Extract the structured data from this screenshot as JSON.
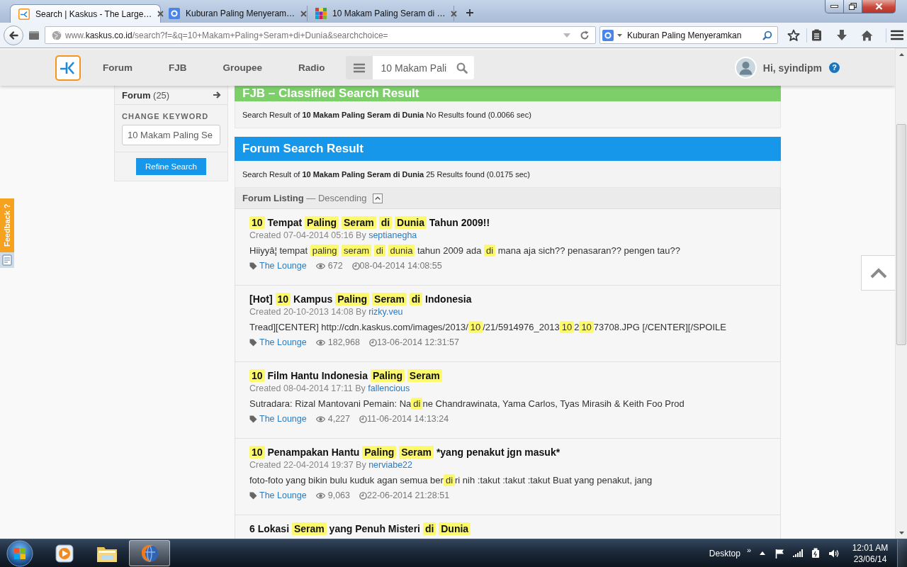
{
  "browser": {
    "tabs": [
      {
        "kind": "forum",
        "title": "Search | Kaskus - The Large…",
        "selected": true
      },
      {
        "kind": "search",
        "title": "Kuburan Paling Menyeram…",
        "selected": false
      },
      {
        "kind": "images",
        "title": "10 Makam Paling Seram di …",
        "selected": false
      }
    ],
    "address": {
      "prefix": "www.",
      "domain": "kaskus.co.id",
      "path": "/search?f=&q=10+Makam+Paling+Seram+di+Dunia&searchchoice="
    },
    "search": {
      "value": "Kuburan Paling Menyeramkan"
    }
  },
  "site_header": {
    "nav": [
      {
        "label": "Forum"
      },
      {
        "label": "FJB"
      },
      {
        "label": "Groupee"
      },
      {
        "label": "Radio"
      }
    ],
    "search": {
      "value": "10 Makam Pali"
    },
    "greeting": "Hi, syindipm",
    "help": "?"
  },
  "sidebar": {
    "category": "**Forum** (25)",
    "keyword_label": "CHANGE KEYWORD",
    "keyword": {
      "value": "10 Makam Paling Se"
    },
    "button": "Refine Search"
  },
  "sections": [
    {
      "kind": "classified",
      "title": "FJB – Classified Search Result",
      "summary": "Search Result of **10 Makam Paling Seram di Dunia** No Results found (0.0066 sec)"
    },
    {
      "kind": "forum",
      "title": "Forum Search Result",
      "summary": "Search Result of **10 Makam Paling Seram di Dunia** 25 Results found (0.0175 sec)"
    }
  ],
  "listing": {
    "label": "**Forum Listing** — Descending"
  },
  "results": [
    {
      "title": [
        {
          "text": "10",
          "highlight": true
        },
        {
          "text": " Tempat ",
          "highlight": false
        },
        {
          "text": "Paling ",
          "highlight": true
        },
        {
          "text": "Seram ",
          "highlight": true
        },
        {
          "text": "di ",
          "highlight": true
        },
        {
          "text": "Dunia",
          "highlight": true
        },
        {
          "text": " Tahun 2009!!",
          "highlight": false
        }
      ],
      "created": "Created 07-04-2014 05:16 By",
      "author": "septianegha",
      "snippet": [
        {
          "text": "Hiiyyâ¦ tempat ",
          "highlight": false
        },
        {
          "text": "paling ",
          "highlight": true
        },
        {
          "text": "seram ",
          "highlight": true
        },
        {
          "text": "di ",
          "highlight": true
        },
        {
          "text": "dunia",
          "highlight": true
        },
        {
          "text": " tahun 2009 ada ",
          "highlight": false
        },
        {
          "text": "di",
          "highlight": true
        },
        {
          "text": " mana aja sich?? penasaran?? pengen tau??",
          "highlight": false
        }
      ],
      "category": "The Lounge",
      "views": "672",
      "updated": "08-04-2014 14:08:55"
    },
    {
      "title": [
        {
          "text": "[Hot] ",
          "highlight": false
        },
        {
          "text": "10",
          "highlight": true
        },
        {
          "text": " Kampus ",
          "highlight": false
        },
        {
          "text": "Paling ",
          "highlight": true
        },
        {
          "text": "Seram ",
          "highlight": true
        },
        {
          "text": "di",
          "highlight": true
        },
        {
          "text": " Indonesia",
          "highlight": false
        }
      ],
      "created": "Created 20-10-2013 14:08 By",
      "author": "rizky.veu",
      "snippet": [
        {
          "text": "Tread][CENTER] http://cdn.kaskus.com/images/2013/",
          "highlight": false
        },
        {
          "text": "10",
          "highlight": true
        },
        {
          "text": "/21/5914976_2013",
          "highlight": false
        },
        {
          "text": "10",
          "highlight": true
        },
        {
          "text": "2",
          "highlight": false
        },
        {
          "text": "10",
          "highlight": true
        },
        {
          "text": "73708.JPG [/CENTER][/SPOILE",
          "highlight": false
        }
      ],
      "category": "The Lounge",
      "views": "182,968",
      "updated": "13-06-2014 12:31:57"
    },
    {
      "title": [
        {
          "text": "10",
          "highlight": true
        },
        {
          "text": " Film Hantu Indonesia ",
          "highlight": false
        },
        {
          "text": "Paling ",
          "highlight": true
        },
        {
          "text": "Seram",
          "highlight": true
        }
      ],
      "created": "Created 08-04-2014 17:11 By",
      "author": "fallencious",
      "snippet": [
        {
          "text": "Sutradara: Rizal Mantovani Pemain: Na",
          "highlight": false
        },
        {
          "text": "di",
          "highlight": true
        },
        {
          "text": "ne Chandrawinata, Yama Carlos, Tyas Mirasih & Keith Foo Prod",
          "highlight": false
        }
      ],
      "category": "The Lounge",
      "views": "4,227",
      "updated": "11-06-2014 14:13:24"
    },
    {
      "title": [
        {
          "text": "10",
          "highlight": true
        },
        {
          "text": " Penampakan Hantu ",
          "highlight": false
        },
        {
          "text": "Paling ",
          "highlight": true
        },
        {
          "text": "Seram",
          "highlight": true
        },
        {
          "text": " *yang penakut jgn masuk*",
          "highlight": false
        }
      ],
      "created": "Created 22-04-2014 19:37 By",
      "author": "nerviabe22",
      "snippet": [
        {
          "text": "foto-foto yang bikin bulu kuduk agan semua ber",
          "highlight": false
        },
        {
          "text": "di",
          "highlight": true
        },
        {
          "text": "ri nih :takut :takut :takut Buat yang penakut, jang",
          "highlight": false
        }
      ],
      "category": "The Lounge",
      "views": "9,063",
      "updated": "22-06-2014 21:28:51"
    },
    {
      "title": [
        {
          "text": "6 Lokasi ",
          "highlight": false
        },
        {
          "text": "Seram",
          "highlight": true
        },
        {
          "text": " yang Penuh Misteri ",
          "highlight": false
        },
        {
          "text": "di ",
          "highlight": true
        },
        {
          "text": "Dunia",
          "highlight": true
        }
      ]
    }
  ],
  "feedback": {
    "label": "Feedback ?"
  },
  "taskbar": {
    "apps": [
      {
        "kind": "media",
        "selected": false
      },
      {
        "kind": "folder",
        "selected": false
      },
      {
        "kind": "browser",
        "selected": true
      }
    ],
    "desktop": "Desktop",
    "overflow": "»",
    "time": "12:01 AM",
    "date": "23/06/14"
  }
}
